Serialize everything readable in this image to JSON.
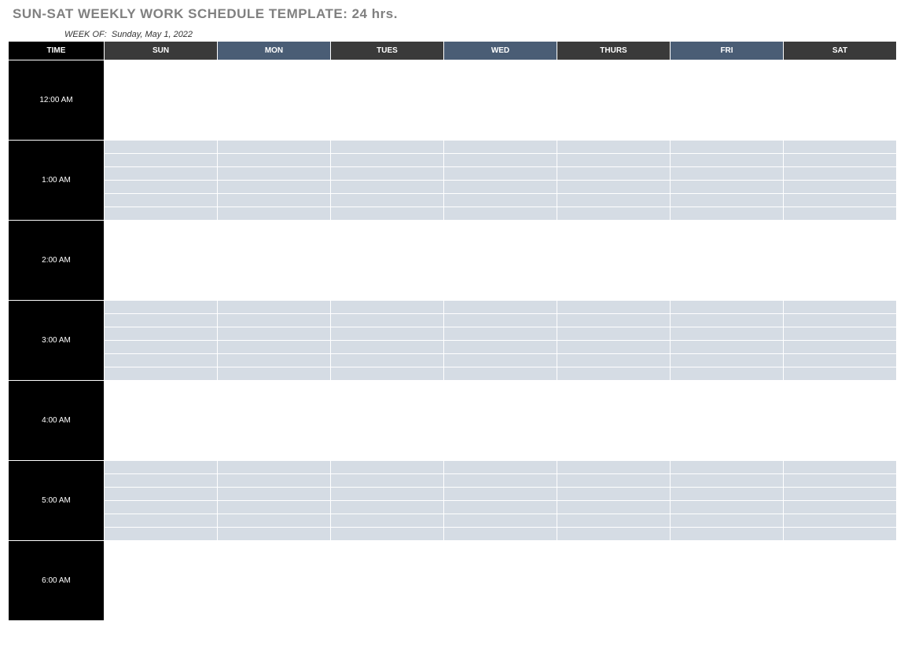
{
  "title": "SUN-SAT WEEKLY WORK SCHEDULE TEMPLATE: 24 hrs.",
  "week_of_label": "WEEK OF:",
  "week_of_date": "Sunday, May 1, 2022",
  "headers": {
    "time": "TIME",
    "days": [
      "SUN",
      "MON",
      "TUES",
      "WED",
      "THURS",
      "FRI",
      "SAT"
    ]
  },
  "day_header_styles": [
    "dark",
    "blue",
    "dark",
    "blue",
    "dark",
    "blue",
    "dark"
  ],
  "time_blocks": [
    {
      "label": "12:00 AM",
      "shaded": false,
      "rows": 6
    },
    {
      "label": "1:00 AM",
      "shaded": true,
      "rows": 6
    },
    {
      "label": "2:00 AM",
      "shaded": false,
      "rows": 6
    },
    {
      "label": "3:00 AM",
      "shaded": true,
      "rows": 6
    },
    {
      "label": "4:00 AM",
      "shaded": false,
      "rows": 6
    },
    {
      "label": "5:00 AM",
      "shaded": true,
      "rows": 6
    },
    {
      "label": "6:00 AM",
      "shaded": false,
      "rows": 6
    }
  ]
}
